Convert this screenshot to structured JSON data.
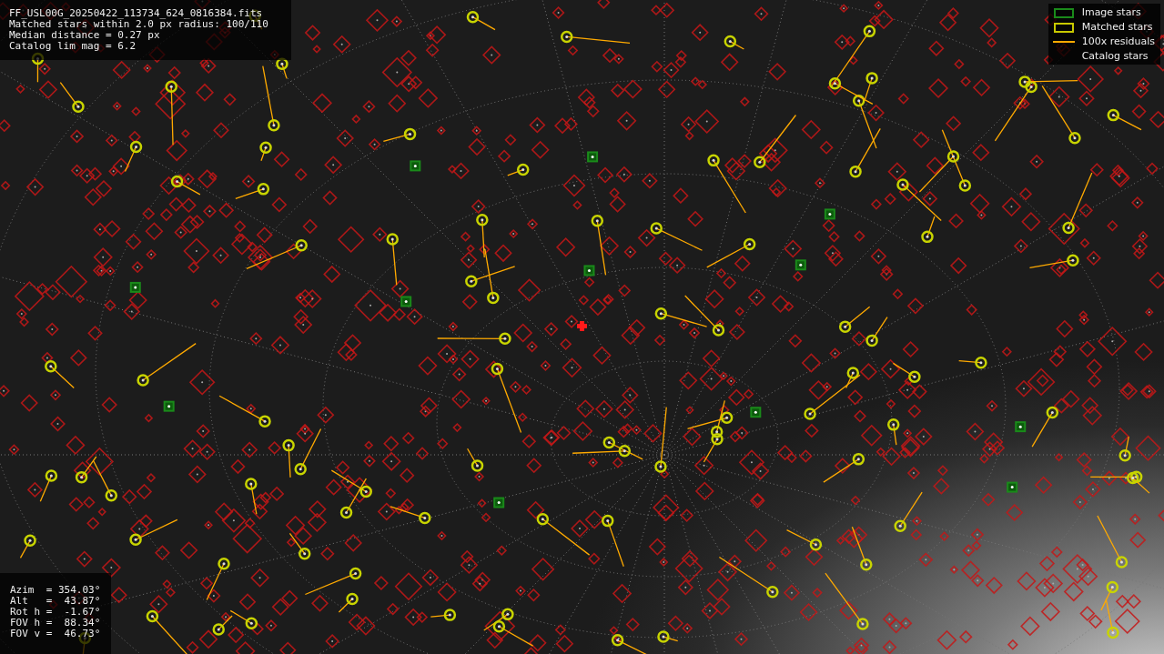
{
  "file_info": [
    "FF_USL00G_20250422_113734_624_0816384.fits",
    "Matched stars within 2.0 px radius: 100/110",
    "Median distance = 0.27 px",
    "Catalog lim mag = 6.2"
  ],
  "legend": [
    {
      "kind": "box",
      "color": "#1a8a1a",
      "label": "Image stars"
    },
    {
      "kind": "box",
      "color": "#c8c800",
      "label": "Matched stars"
    },
    {
      "kind": "line",
      "color": "#ffaa00",
      "label": "100x residuals"
    },
    {
      "kind": "none",
      "label": "Catalog stars"
    }
  ],
  "pointing": [
    "Azim  = 354.03°",
    "Alt   =  43.87°",
    "Rot h =  -1.67°",
    "FOV h =  88.34°",
    "FOV v =  46.73°"
  ]
}
